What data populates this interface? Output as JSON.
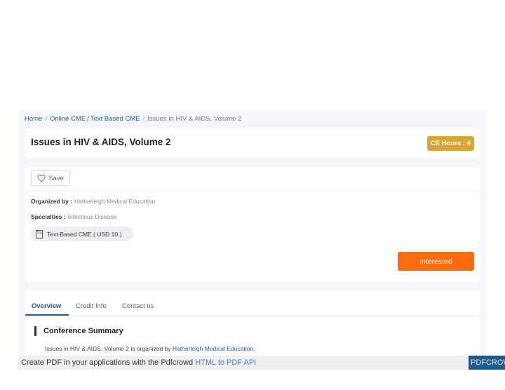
{
  "breadcrumb": {
    "home": "Home",
    "separator": "/",
    "online_cme": "Online CME",
    "inner_separator": "/",
    "text_based": "Text Based CME",
    "current": "Issues in HIV & AIDS, Volume 2"
  },
  "event": {
    "title": "Issues in HIV & AIDS, Volume 2",
    "ce_hours_label": "CE Hours : 4",
    "save_label": "Save",
    "organized_by_label": "Organized by :",
    "organized_by_value": "Hatherleigh Medical Education",
    "specialties_label": "Specialties :",
    "specialties_value": "Infectious Disease",
    "type_pill": "Text-Based CME ( USD 10 )",
    "type_icon_glyph": "T≡",
    "interested_label": "Interested"
  },
  "tabs": [
    {
      "label": "Overview",
      "active": true
    },
    {
      "label": "Credit Info",
      "active": false
    },
    {
      "label": "Contact us",
      "active": false
    }
  ],
  "overview": {
    "heading": "Conference Summary",
    "summary_prefix": "Issues in HIV & AIDS, Volume 2 is organized by ",
    "summary_link": "Hatherleigh Medical Education",
    "summary_suffix": "."
  },
  "pdf_banner": {
    "text": "Create PDF in your applications with the Pdfcrowd ",
    "link": "HTML to PDF API",
    "logo": "PDFCROWD"
  },
  "colors": {
    "accent_blue": "#2a5a9e",
    "badge_gold": "#dca531",
    "interested_orange": "#ff6b0c",
    "page_bg": "#f6f7fc",
    "pdf_logo_bg": "#1e5a8a"
  }
}
